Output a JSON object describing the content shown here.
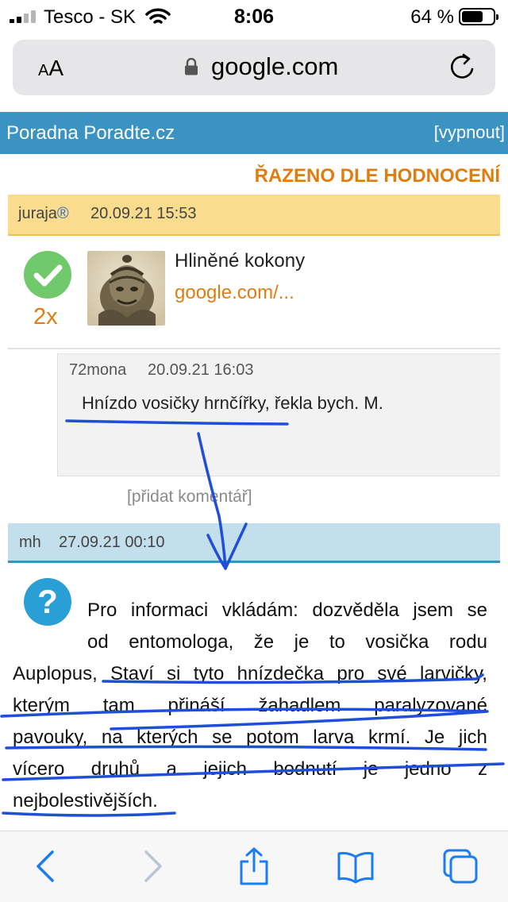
{
  "status_bar": {
    "carrier": "Tesco - SK",
    "time": "8:06",
    "battery_percent": "64 %",
    "signal_bars": 2,
    "battery_level": 0.64
  },
  "url_bar": {
    "text_size_label": "AA",
    "host": "google.com"
  },
  "header": {
    "site_title": "Poradna Poradte.cz",
    "off_link": "[vypnout]"
  },
  "sort_label": "ŘAZENO DLE HODNOCENÍ",
  "answer1": {
    "author": "juraja",
    "registered_mark": "®",
    "date": "20.09.21 15:53",
    "votes": "2x",
    "title": "Hliněné kokony",
    "link": "google.com/..."
  },
  "comment": {
    "author": "72mona",
    "date": "20.09.21 16:03",
    "text": "Hnízdo vosičky hrnčířky, řekla bych. M.",
    "add_comment": "[přidat komentář]"
  },
  "answer2": {
    "author": "mh",
    "date": "27.09.21 00:10",
    "lines": [
      [
        "Pro",
        "informaci",
        "vkládám:",
        "dozvěděla",
        "jsem",
        "se"
      ],
      [
        "od",
        "entomologa,",
        "že",
        "je",
        "to",
        "vosička",
        "rodu"
      ],
      [
        "Auplopus,",
        "Staví",
        "si",
        "tyto",
        "hnízdečka",
        "pro",
        "své",
        "larvičky,"
      ],
      [
        "kterým",
        "tam",
        "přináší",
        "žahadlem",
        "paralyzované"
      ],
      [
        "pavouky,",
        "na",
        "kterých",
        "se",
        "potom",
        "larva",
        "krmí.",
        "Je",
        "jich"
      ],
      [
        "vícero",
        "druhů",
        "a",
        "jejich",
        "bodnutí",
        "je",
        "jedno",
        "z"
      ]
    ],
    "last_line": "nejbolestivější ch.",
    "last_line_text": "nejbolestivějších."
  },
  "colors": {
    "header_blue": "#3a93c0",
    "accent_orange": "#e07d10",
    "answer_head_yellow": "#f9dc8d",
    "answer_head_blue": "#c2dfeb",
    "annotation_blue": "#1f4fd8"
  },
  "toolbar": {
    "icons": [
      "back-icon",
      "forward-icon",
      "share-icon",
      "bookmarks-icon",
      "tabs-icon"
    ]
  }
}
